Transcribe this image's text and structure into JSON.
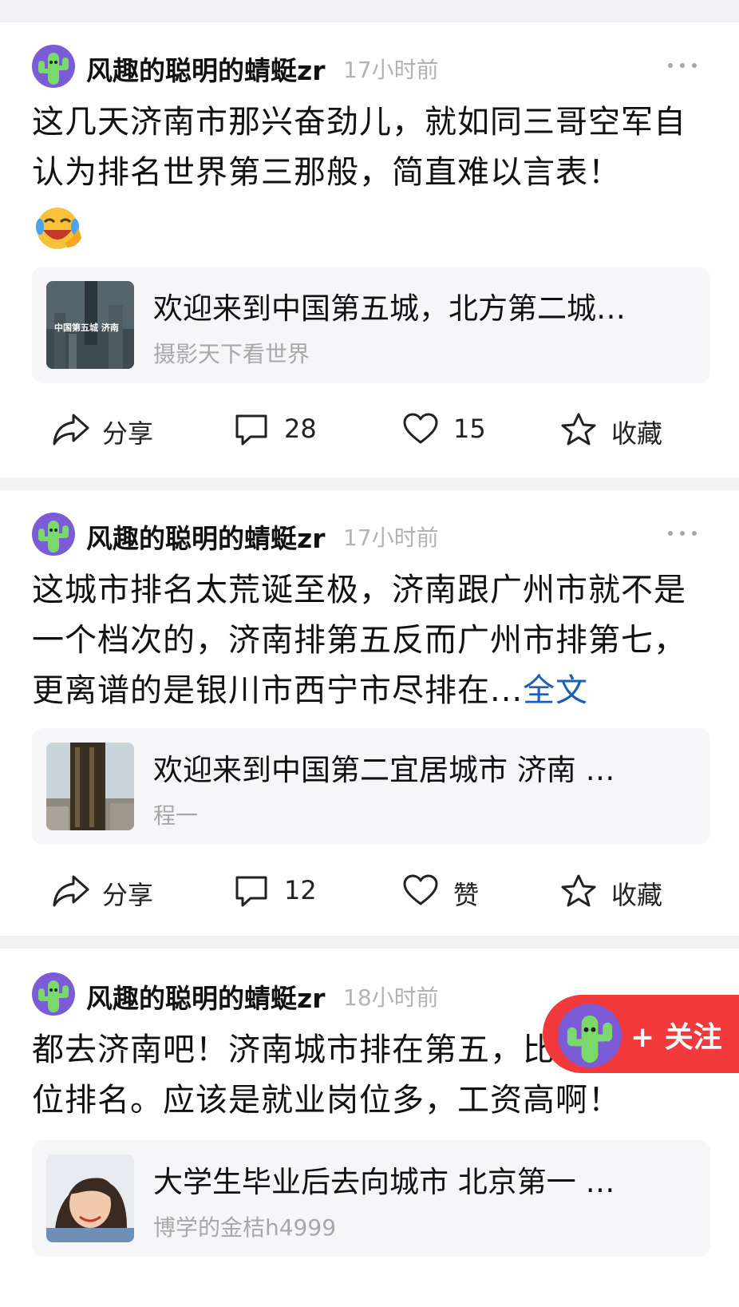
{
  "posts": [
    {
      "author": "风趣的聪明的蜻蜓zr",
      "time": "17小时前",
      "text": "这几天济南市那兴奋劲儿，就如同三哥空军自认为排名世界第三那般，简直难以言表！",
      "emoji": "laughing-crying-emoji",
      "card": {
        "title": "欢迎来到中国第五城，北方第二城…",
        "source": "摄影天下看世界",
        "thumb_text": "中国第五城 济南"
      },
      "actions": {
        "share": "分享",
        "comment": "28",
        "like": "15",
        "collect": "收藏"
      }
    },
    {
      "author": "风趣的聪明的蜻蜓zr",
      "time": "17小时前",
      "text": "这城市排名太荒诞至极，济南跟广州市就不是一个档次的，济南排第五反而广州市排第七，更离谱的是银川市西宁市尽排在...",
      "more": "全文",
      "card": {
        "title": "欢迎来到中国第二宜居城市 济南 …",
        "source": "程一"
      },
      "actions": {
        "share": "分享",
        "comment": "12",
        "like": "赞",
        "collect": "收藏"
      }
    },
    {
      "author": "风趣的聪明的蜻蜓zr",
      "time": "18小时前",
      "text": "都去济南吧！济南城市排在第五，比苏州高30位排名。应该是就业岗位多，工资高啊！",
      "card": {
        "title": "大学生毕业后去向城市 北京第一 …",
        "source": "博学的金桔h4999"
      }
    }
  ],
  "follow": {
    "label": "+ 关注"
  },
  "colors": {
    "link": "#1d5fb4",
    "follow_bg": "#f23a3c",
    "avatar_bg": "#7c5cd6",
    "cactus": "#7bd96b"
  },
  "icons": [
    "share-icon",
    "comment-icon",
    "heart-icon",
    "star-icon",
    "more-icon",
    "cactus-avatar-icon"
  ]
}
